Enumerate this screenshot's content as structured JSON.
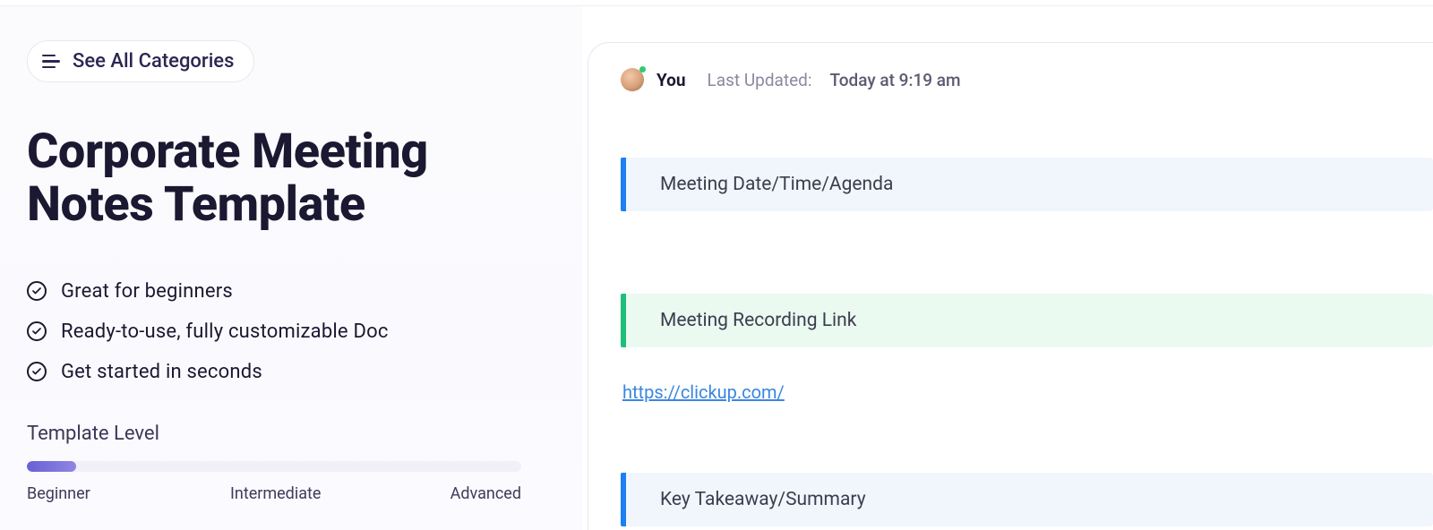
{
  "nav": {
    "categories_label": "See All Categories"
  },
  "title": "Corporate Meeting Notes Template",
  "benefits": [
    "Great for beginners",
    "Ready-to-use, fully customizable Doc",
    "Get started in seconds"
  ],
  "level": {
    "label": "Template Level",
    "ticks": [
      "Beginner",
      "Intermediate",
      "Advanced"
    ],
    "value_percent": 10
  },
  "doc": {
    "author": "You",
    "updated_label": "Last Updated:",
    "updated_time": "Today at 9:19 am",
    "blocks": {
      "agenda": "Meeting Date/Time/Agenda",
      "recording": "Meeting Recording Link",
      "link": "https://clickup.com/",
      "summary": "Key Takeaway/Summary"
    }
  }
}
